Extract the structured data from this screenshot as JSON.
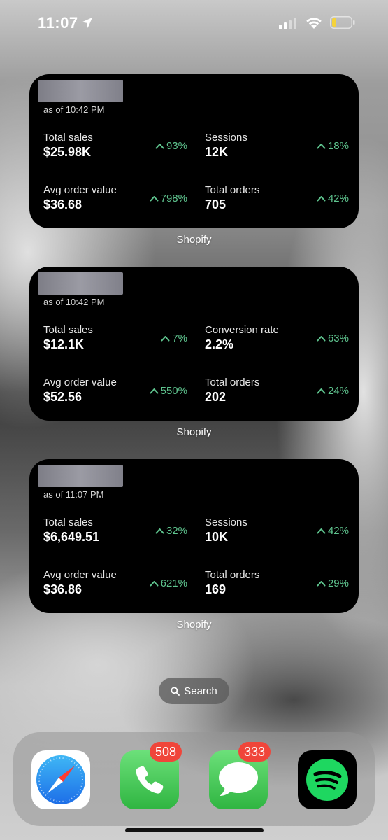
{
  "status_bar": {
    "time": "11:07",
    "icons": [
      "location-arrow-icon",
      "cellular-signal-icon",
      "wifi-icon",
      "battery-low-icon"
    ],
    "battery_color": "#f5d33a"
  },
  "widgets": [
    {
      "as_of": "as of 10:42 PM",
      "metrics": [
        {
          "label": "Total sales",
          "value": "$25.98K",
          "change": "93%"
        },
        {
          "label": "Sessions",
          "value": "12K",
          "change": "18%"
        },
        {
          "label": "Avg order value",
          "value": "$36.68",
          "change": "798%"
        },
        {
          "label": "Total orders",
          "value": "705",
          "change": "42%"
        }
      ],
      "caption": "Shopify"
    },
    {
      "as_of": "as of 10:42 PM",
      "metrics": [
        {
          "label": "Total sales",
          "value": "$12.1K",
          "change": "7%"
        },
        {
          "label": "Conversion rate",
          "value": "2.2%",
          "change": "63%"
        },
        {
          "label": "Avg order value",
          "value": "$52.56",
          "change": "550%"
        },
        {
          "label": "Total orders",
          "value": "202",
          "change": "24%"
        }
      ],
      "caption": "Shopify"
    },
    {
      "as_of": "as of 11:07 PM",
      "metrics": [
        {
          "label": "Total sales",
          "value": "$6,649.51",
          "change": "32%"
        },
        {
          "label": "Sessions",
          "value": "10K",
          "change": "42%"
        },
        {
          "label": "Avg order value",
          "value": "$36.86",
          "change": "621%"
        },
        {
          "label": "Total orders",
          "value": "169",
          "change": "29%"
        }
      ],
      "caption": "Shopify"
    }
  ],
  "positive_change_color": "#5fc58f",
  "search": {
    "label": "Search",
    "icon": "search-icon"
  },
  "dock": {
    "apps": [
      {
        "name": "Safari",
        "icon": "safari-compass-icon",
        "badge": ""
      },
      {
        "name": "Phone",
        "icon": "phone-handset-icon",
        "badge": "508"
      },
      {
        "name": "Messages",
        "icon": "speech-bubble-icon",
        "badge": "333"
      },
      {
        "name": "Spotify",
        "icon": "spotify-icon",
        "badge": ""
      }
    ],
    "badge_color": "#f0453a"
  }
}
